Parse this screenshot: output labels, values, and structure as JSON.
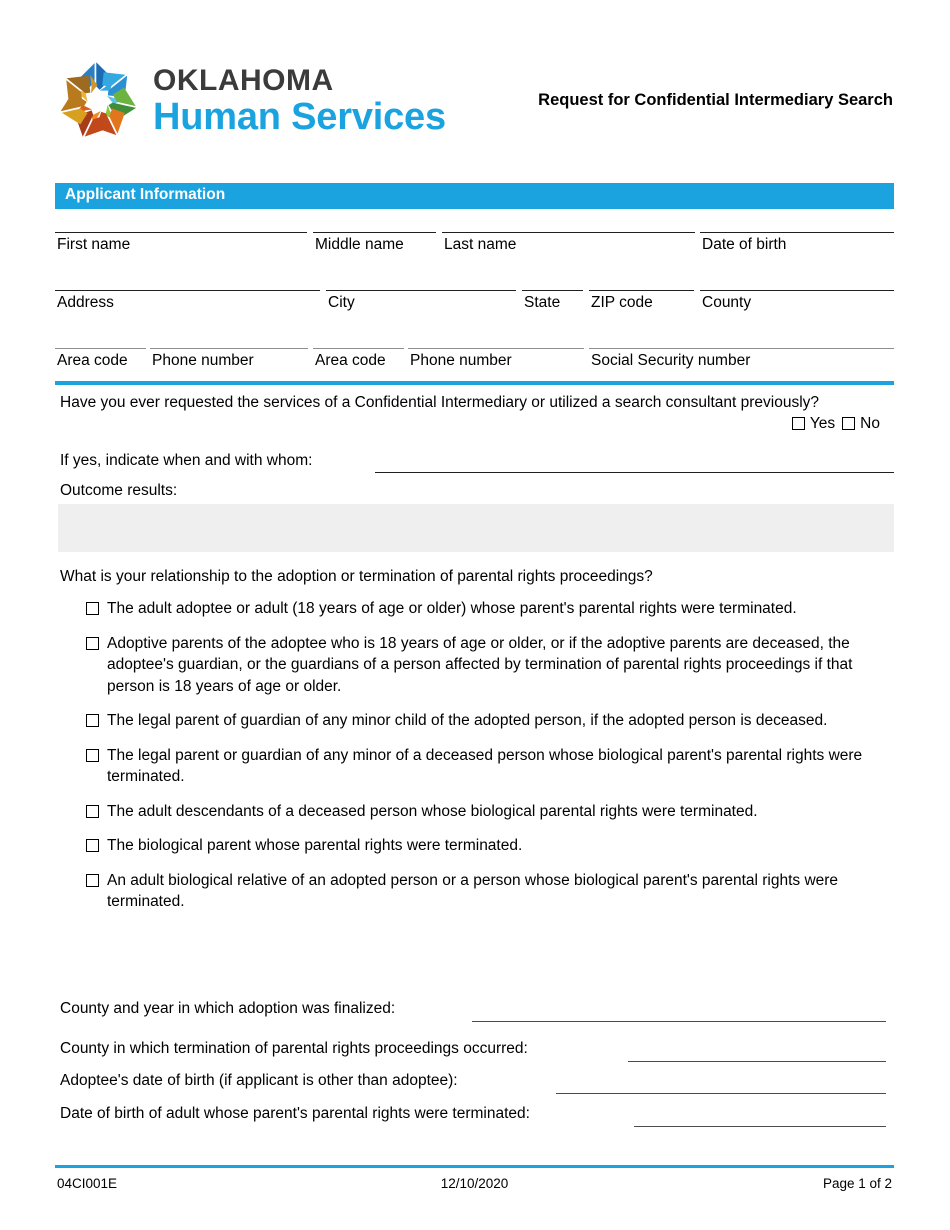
{
  "header": {
    "logo_line1": "OKLAHOMA",
    "logo_line2": "Human Services",
    "form_title": "Request for Confidential Intermediary Search",
    "accent_color": "#1BA3E0",
    "logo_text_color": "#3b3b3b"
  },
  "section": {
    "applicant_information": "Applicant Information"
  },
  "fields": {
    "row1": [
      {
        "label": "First name",
        "value": ""
      },
      {
        "label": "Middle name",
        "value": ""
      },
      {
        "label": "Last name",
        "value": ""
      },
      {
        "label": "Date of birth",
        "value": ""
      }
    ],
    "row2": [
      {
        "label": "Address",
        "value": ""
      },
      {
        "label": "City",
        "value": ""
      },
      {
        "label": "State",
        "value": ""
      },
      {
        "label": "ZIP code",
        "value": ""
      },
      {
        "label": "County",
        "value": ""
      }
    ],
    "row3": [
      {
        "label": "Area code",
        "value": ""
      },
      {
        "label": "Phone number",
        "value": ""
      },
      {
        "label": "Area code",
        "value": ""
      },
      {
        "label": "Phone number",
        "value": ""
      },
      {
        "label": "Social Security number",
        "value": ""
      }
    ]
  },
  "previous_request": {
    "question": "Have you ever requested the services of a Confidential Intermediary or utilized a search consultant previously?",
    "yes_label": "Yes",
    "no_label": "No",
    "yes_checked": false,
    "no_checked": false,
    "if_yes_label": "If yes, indicate when and with whom:",
    "if_yes_value": "",
    "outcome_label": "Outcome results:",
    "outcome_value": ""
  },
  "relationship": {
    "question": "What is your relationship to the adoption or termination of parental rights proceedings?",
    "options": [
      {
        "text": "The adult adoptee or adult (18 years of age or older) whose parent's parental rights were terminated.",
        "checked": false
      },
      {
        "text": "Adoptive parents of the adoptee who is 18 years of age or older, or if the adoptive parents are deceased, the adoptee's guardian, or the guardians of a person affected by termination of parental rights proceedings if that person is 18 years of age or older.",
        "checked": false
      },
      {
        "text": "The legal parent of guardian of any minor child of the adopted person, if the adopted person is deceased.",
        "checked": false
      },
      {
        "text": "The legal parent or guardian of any minor of a deceased person whose biological parent's parental rights were terminated.",
        "checked": false
      },
      {
        "text": "The adult descendants of a deceased person whose biological parental rights were terminated.",
        "checked": false
      },
      {
        "text": "The biological parent whose parental rights were terminated.",
        "checked": false
      },
      {
        "text": "An adult biological relative of an adopted person or a person whose biological parent's parental rights were terminated.",
        "checked": false
      }
    ]
  },
  "details": [
    {
      "label": "County and year in which adoption was finalized:",
      "value": ""
    },
    {
      "label": "County in which termination of parental rights proceedings occurred:",
      "value": ""
    },
    {
      "label": "Adoptee's date of birth (if applicant is other than adoptee):",
      "value": ""
    },
    {
      "label": "Date of birth of adult whose parent's parental rights were terminated:",
      "value": ""
    }
  ],
  "footer": {
    "form_number": "04CI001E",
    "date": "12/10/2020",
    "page": "Page 1 of 2"
  }
}
